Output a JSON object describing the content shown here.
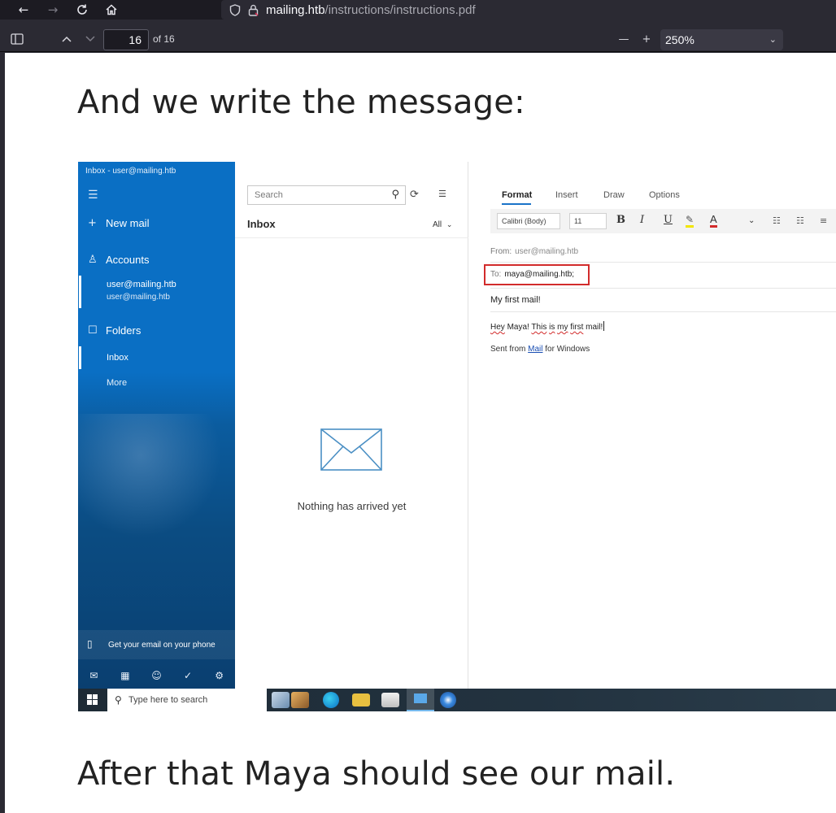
{
  "browser": {
    "url_domain": "mailing.htb",
    "url_path": "/instructions/instructions.pdf",
    "icons": {
      "back": "arrow-left-icon",
      "forward": "arrow-right-icon",
      "reload": "reload-icon",
      "home": "home-icon",
      "tracking": "shield-icon",
      "lock": "lock-icon"
    }
  },
  "pdf_toolbar": {
    "page_number": "16",
    "page_of": "of 16",
    "zoom": "250%"
  },
  "document": {
    "heading_top": "And we write the message:",
    "heading_bottom": "After that Maya should see our mail."
  },
  "screenshot": {
    "sidebar": {
      "window_title": "Inbox - user@mailing.htb",
      "new_mail": "New mail",
      "accounts": "Accounts",
      "account_name": "user@mailing.htb",
      "account_sub": "user@mailing.htb",
      "folders": "Folders",
      "inbox": "Inbox",
      "more": "More",
      "phone_promo": "Get your email on your phone"
    },
    "list": {
      "search_placeholder": "Search",
      "title": "Inbox",
      "filter": "All",
      "empty_message": "Nothing has arrived yet"
    },
    "compose": {
      "tabs": [
        "Format",
        "Insert",
        "Draw",
        "Options"
      ],
      "font_name": "Calibri (Body)",
      "font_size": "11",
      "bold": "B",
      "italic": "I",
      "underline": "U",
      "font_color": "A",
      "from_label": "From:",
      "from_value": "user@mailing.htb",
      "to_label": "To:",
      "to_value": "maya@mailing.htb;",
      "subject": "My first mail!",
      "body_words": [
        "Hey",
        "Maya!",
        "This",
        "is",
        "my",
        "first",
        "mail!"
      ],
      "signature_prefix": "Sent from ",
      "signature_link": "Mail",
      "signature_suffix": " for Windows"
    },
    "taskbar": {
      "search_placeholder": "Type here to search"
    },
    "colors": {
      "sidebar_blue": "#0a6fc4",
      "highlight_red": "#d22b2b",
      "accent_blue": "#1a73c8"
    }
  }
}
